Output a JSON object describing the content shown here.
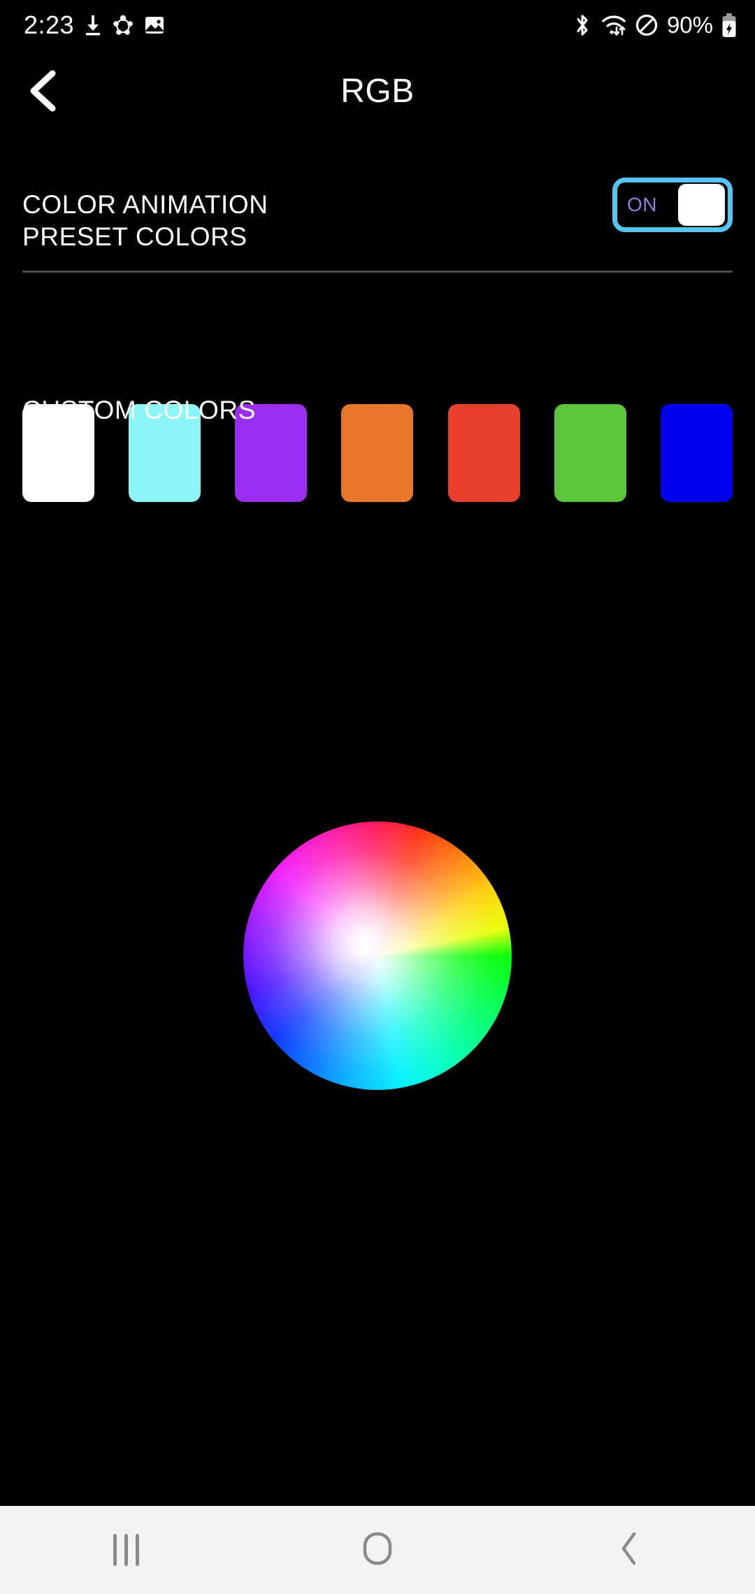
{
  "status_bar": {
    "time": "2:23",
    "left_icons": [
      "download-icon",
      "sharing-icon",
      "image-icon"
    ],
    "right_icons": [
      "bluetooth-icon",
      "wifi-icon",
      "do-not-disturb-icon"
    ],
    "battery_percent": "90%",
    "battery_state": "charging"
  },
  "app_bar": {
    "back_icon": "chevron-left-icon",
    "title": "RGB"
  },
  "color_animation": {
    "label": "COLOR ANIMATION",
    "toggle_state": "ON",
    "toggle_on": true,
    "border_color": "#53c6f2",
    "text_color": "#8e7fd8",
    "thumb_color": "#ffffff"
  },
  "preset_colors": {
    "title": "PRESET COLORS",
    "swatches": [
      {
        "name": "white",
        "hex": "#ffffff"
      },
      {
        "name": "cyan",
        "hex": "#8cf6f6"
      },
      {
        "name": "purple",
        "hex": "#9b2ef2"
      },
      {
        "name": "orange",
        "hex": "#e8762b"
      },
      {
        "name": "red",
        "hex": "#e8402f"
      },
      {
        "name": "green",
        "hex": "#5bc63c"
      },
      {
        "name": "blue",
        "hex": "#0000ee"
      }
    ]
  },
  "custom_colors": {
    "title": "CUSTOM COLORS",
    "picker": "color-wheel"
  },
  "nav_bar": {
    "background": "#f3f3f3",
    "icon_color": "#8a8a8a",
    "buttons": [
      {
        "name": "recents",
        "icon": "recents-icon"
      },
      {
        "name": "home",
        "icon": "home-icon"
      },
      {
        "name": "back",
        "icon": "back-chevron-icon"
      }
    ]
  }
}
